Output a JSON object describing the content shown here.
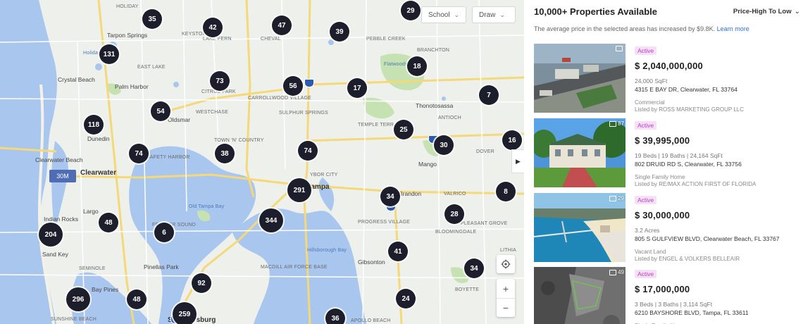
{
  "map": {
    "filters": {
      "school_label": "School",
      "draw_label": "Draw"
    },
    "selected_price_label": "30M",
    "places": [
      {
        "name": "Holiday",
        "cls": ""
      },
      {
        "name": "Tarpon Springs",
        "cls": "mid"
      },
      {
        "name": "Holiday Bayou",
        "cls": "water"
      },
      {
        "name": "East Lake",
        "cls": ""
      },
      {
        "name": "Keystone",
        "cls": ""
      },
      {
        "name": "Lake Fern",
        "cls": ""
      },
      {
        "name": "Cheval",
        "cls": ""
      },
      {
        "name": "Pebble Creek",
        "cls": ""
      },
      {
        "name": "Branchton",
        "cls": ""
      },
      {
        "name": "Crystal Beach",
        "cls": "mid"
      },
      {
        "name": "Palm Harbor",
        "cls": "mid"
      },
      {
        "name": "Citrus Park",
        "cls": ""
      },
      {
        "name": "Carrollwood Village",
        "cls": ""
      },
      {
        "name": "Flatwoods",
        "cls": "water"
      },
      {
        "name": "Thonotosassa",
        "cls": "mid"
      },
      {
        "name": "Westchase",
        "cls": ""
      },
      {
        "name": "Oldsmar",
        "cls": "mid"
      },
      {
        "name": "Dunedin",
        "cls": "mid"
      },
      {
        "name": "Sulphur Springs",
        "cls": ""
      },
      {
        "name": "Temple Terrace",
        "cls": ""
      },
      {
        "name": "Antioch",
        "cls": ""
      },
      {
        "name": "Town 'N' Country",
        "cls": ""
      },
      {
        "name": "Safety Harbor",
        "cls": ""
      },
      {
        "name": "Clearwater Beach",
        "cls": "mid"
      },
      {
        "name": "Clearwater",
        "cls": "big"
      },
      {
        "name": "Tampa",
        "cls": "big"
      },
      {
        "name": "Ybor City",
        "cls": ""
      },
      {
        "name": "Brandon",
        "cls": "mid"
      },
      {
        "name": "Mango",
        "cls": "mid"
      },
      {
        "name": "Valrico",
        "cls": ""
      },
      {
        "name": "Dover",
        "cls": ""
      },
      {
        "name": "Largo",
        "cls": "mid"
      },
      {
        "name": "Old Tampa Bay",
        "cls": "water"
      },
      {
        "name": "Indian Rocks",
        "cls": "mid"
      },
      {
        "name": "Feather Sound",
        "cls": ""
      },
      {
        "name": "Progress Village",
        "cls": ""
      },
      {
        "name": "Bloomingdale",
        "cls": ""
      },
      {
        "name": "Pleasant Grove",
        "cls": ""
      },
      {
        "name": "Sand Key",
        "cls": "mid"
      },
      {
        "name": "Seminole",
        "cls": ""
      },
      {
        "name": "Pinellas Park",
        "cls": "mid"
      },
      {
        "name": "Hillsborough Bay",
        "cls": "water"
      },
      {
        "name": "MacDill Air Force Base",
        "cls": ""
      },
      {
        "name": "Gibsonton",
        "cls": "mid"
      },
      {
        "name": "Bay Pines",
        "cls": "mid"
      },
      {
        "name": "Lithia",
        "cls": ""
      },
      {
        "name": "Boyette",
        "cls": ""
      },
      {
        "name": "Sunshine Beach",
        "cls": ""
      },
      {
        "name": "St. Petersburg",
        "cls": "big"
      },
      {
        "name": "Apollo Beach",
        "cls": ""
      }
    ],
    "clusters": [
      "35",
      "42",
      "47",
      "39",
      "29",
      "131",
      "73",
      "56",
      "17",
      "18",
      "7",
      "54",
      "118",
      "74",
      "38",
      "74",
      "25",
      "30",
      "16",
      "291",
      "34",
      "8",
      "48",
      "344",
      "28",
      "6",
      "204",
      "41",
      "92",
      "34",
      "296",
      "48",
      "259",
      "24",
      "36"
    ]
  },
  "panel": {
    "title": "10,000+ Properties Available",
    "sort_label": "Price-High To Low",
    "avg_text": "The average price in the selected areas has increased by $9.8K.",
    "learn_more": "Learn more",
    "listings": [
      {
        "status": "Active",
        "price": "$ 2,040,000,000",
        "facts": "24,000 SqFt",
        "address": "4315 E BAY DR, Clearwater, FL 33764",
        "type": "Commercial",
        "broker": "Listed by ROSS MARKETING GROUP LLC",
        "photo_count": ""
      },
      {
        "status": "Active",
        "price": "$ 39,995,000",
        "facts": "19 Beds  |  19 Baths  |  24,164 SqFt",
        "address": "802 DRUID RD S, Clearwater, FL 33756",
        "type": "Single Family Home",
        "broker": "Listed by RE/MAX ACTION FIRST OF FLORIDA",
        "photo_count": "87"
      },
      {
        "status": "Active",
        "price": "$ 30,000,000",
        "facts": "3.2 Acres",
        "address": "805 S GULFVIEW BLVD, Clearwater Beach, FL 33767",
        "type": "Vacant Land",
        "broker": "Listed by ENGEL & VOLKERS BELLEAIR",
        "photo_count": "29"
      },
      {
        "status": "Active",
        "price": "$ 17,000,000",
        "facts": "3 Beds  |  3 Baths  |  3,114 SqFt",
        "address": "6210 BAYSHORE BLVD, Tampa, FL 33611",
        "type": "Single Family Home",
        "broker": "",
        "photo_count": "49"
      }
    ]
  }
}
